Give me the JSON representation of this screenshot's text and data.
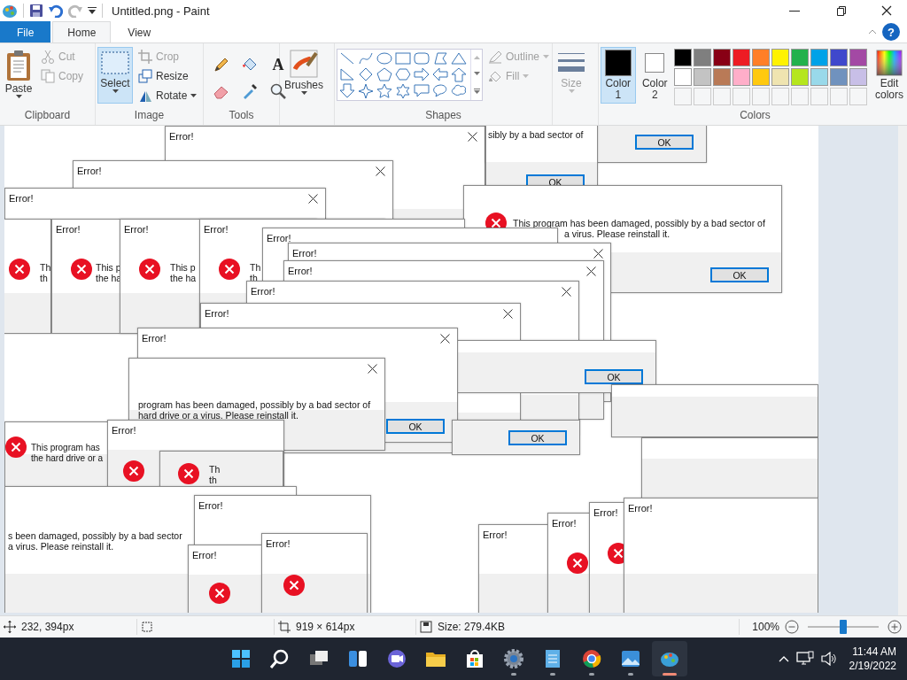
{
  "window": {
    "title": "Untitled.png - Paint"
  },
  "menu_tabs": [
    {
      "label": "File",
      "kind": "file",
      "selected": false
    },
    {
      "label": "Home",
      "kind": "tab",
      "selected": true
    },
    {
      "label": "View",
      "kind": "tab",
      "selected": false
    }
  ],
  "help": "?",
  "ribbon": {
    "clipboard": {
      "label": "Clipboard",
      "paste": "Paste",
      "cut": {
        "label": "Cut",
        "disabled": true
      },
      "copy": {
        "label": "Copy",
        "disabled": true
      }
    },
    "image": {
      "label": "Image",
      "select": {
        "label": "Select",
        "selected": true
      },
      "crop": {
        "label": "Crop",
        "disabled": true
      },
      "resize": {
        "label": "Resize",
        "disabled": false
      },
      "rotate": {
        "label": "Rotate",
        "disabled": false
      }
    },
    "tools": {
      "label": "Tools",
      "text_tool": "A"
    },
    "brushes": {
      "label": "Brushes"
    },
    "shapes": {
      "label": "Shapes",
      "outline": {
        "label": "Outline",
        "disabled": true
      },
      "fill": {
        "label": "Fill",
        "disabled": true
      }
    },
    "size": {
      "label": "Size",
      "disabled": true
    },
    "colors": {
      "label": "Colors",
      "color1": {
        "label": "Color",
        "index": "1",
        "color": "#000000",
        "selected": true
      },
      "color2": {
        "label": "Color",
        "index": "2",
        "color": "#ffffff",
        "selected": false
      },
      "palette": [
        {
          "color": "#000000"
        },
        {
          "color": "#7f7f7f"
        },
        {
          "color": "#880015"
        },
        {
          "color": "#ed1c24"
        },
        {
          "color": "#ff7f27"
        },
        {
          "color": "#fff200"
        },
        {
          "color": "#22b14c"
        },
        {
          "color": "#00a2e8"
        },
        {
          "color": "#3f48cc"
        },
        {
          "color": "#a349a4"
        },
        {
          "color": "#ffffff"
        },
        {
          "color": "#c3c3c3"
        },
        {
          "color": "#b97a57"
        },
        {
          "color": "#ffaec9"
        },
        {
          "color": "#ffc90e"
        },
        {
          "color": "#efe4b0"
        },
        {
          "color": "#b5e61d"
        },
        {
          "color": "#99d9ea"
        },
        {
          "color": "#7092be"
        },
        {
          "color": "#c8bfe7"
        }
      ],
      "edit": "Edit colors"
    }
  },
  "canvas": {
    "dialogs": [
      {
        "kind": "plain",
        "title": "Error!"
      },
      {
        "kind": "plain",
        "button": "OK"
      },
      {
        "kind": "plain",
        "message": [
          "sibly by a bad sector of"
        ],
        "button": "OK"
      },
      {
        "kind": "error",
        "message": [
          "This program has been damaged, possibly by a bad sector of",
          "a virus. Please reinstall it."
        ],
        "button": "OK"
      },
      {
        "kind": "plain",
        "title": "Error!"
      },
      {
        "kind": "plain",
        "title": "Error!"
      },
      {
        "kind": "error",
        "message": [
          "Th",
          "th"
        ]
      },
      {
        "kind": "error",
        "title": "Error!",
        "message": [
          "This p",
          "the ha"
        ]
      },
      {
        "kind": "error",
        "title": "Error!",
        "message": [
          "This p",
          "the ha"
        ]
      },
      {
        "kind": "error",
        "title": "Error!",
        "message": [
          "Th",
          "th"
        ]
      },
      {
        "kind": "plain",
        "title": "Error!"
      },
      {
        "kind": "plain",
        "title": "Error!"
      },
      {
        "kind": "plain",
        "title": "Error!"
      },
      {
        "kind": "plain",
        "title": "Error!"
      },
      {
        "kind": "plain",
        "title": "Error!"
      },
      {
        "kind": "plain",
        "button": "OK"
      },
      {
        "kind": "plain",
        "title": "Error!",
        "button": "OK"
      },
      {
        "kind": "plain",
        "button": "OK"
      },
      {
        "kind": "plain",
        "message": [
          "program has been damaged, possibly by a bad sector of",
          "hard drive or a virus. Please reinstall it."
        ]
      },
      {
        "kind": "plain"
      },
      {
        "kind": "plain"
      },
      {
        "kind": "error",
        "message": [
          "This program has",
          "the hard drive or a"
        ]
      },
      {
        "kind": "error",
        "title": "Error!"
      },
      {
        "kind": "error",
        "message": [
          "Th",
          "th"
        ]
      },
      {
        "kind": "plain",
        "message": [
          "s been damaged, possibly by a bad sector",
          "a virus. Please reinstall it."
        ]
      },
      {
        "kind": "plain",
        "title": "Error!"
      },
      {
        "kind": "error",
        "title": "Error!"
      },
      {
        "kind": "error",
        "title": "Error!"
      },
      {
        "kind": "plain",
        "title": "Error!"
      },
      {
        "kind": "error",
        "title": "Error!"
      },
      {
        "kind": "error",
        "title": "Error!"
      },
      {
        "kind": "plain",
        "title": "Error!"
      }
    ]
  },
  "status_bar": {
    "position": "232, 394px",
    "size": "919 × 614px",
    "file_size": "Size: 279.4KB",
    "zoom": "100%",
    "zoom_slider": {
      "level": 0.5
    }
  },
  "taskbar": {
    "apps": [
      {
        "kind": "start",
        "running": false,
        "active": false
      },
      {
        "kind": "search",
        "running": false,
        "active": false
      },
      {
        "kind": "taskview",
        "running": false,
        "active": false
      },
      {
        "kind": "widgets",
        "running": false,
        "active": false
      },
      {
        "kind": "chat",
        "running": false,
        "active": false
      },
      {
        "kind": "explorer",
        "running": false,
        "active": false
      },
      {
        "kind": "store",
        "running": false,
        "active": false
      },
      {
        "kind": "settings",
        "running": true,
        "active": false
      },
      {
        "kind": "notepad",
        "running": true,
        "active": false
      },
      {
        "kind": "chrome",
        "running": true,
        "active": false
      },
      {
        "kind": "photos",
        "running": true,
        "active": false
      },
      {
        "kind": "paint",
        "running": true,
        "active": true
      }
    ],
    "time": "11:44 AM",
    "date": "2/19/2022"
  }
}
